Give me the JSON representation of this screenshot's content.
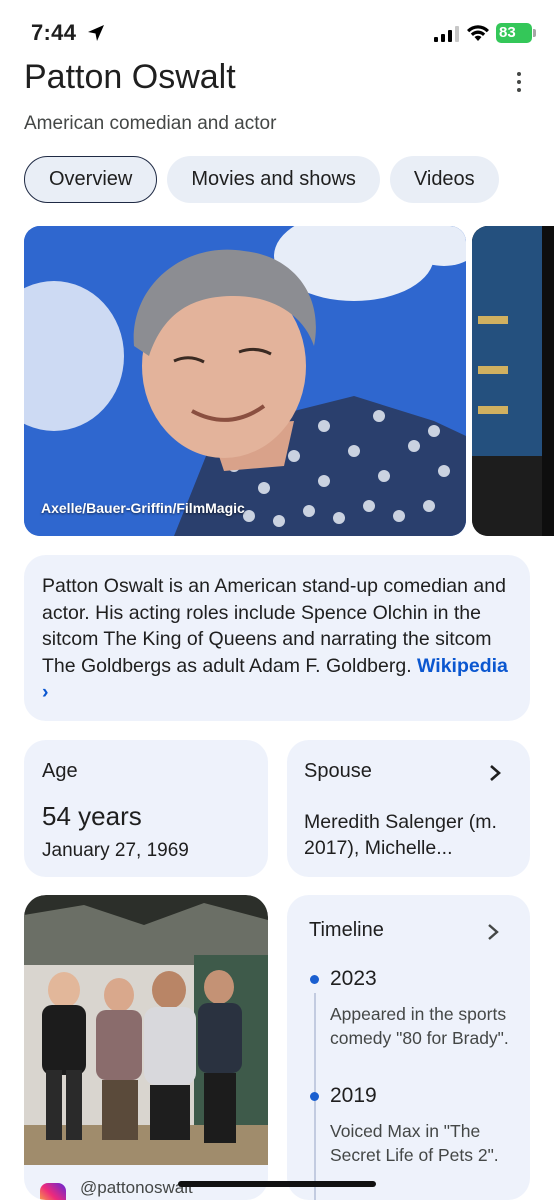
{
  "status_bar": {
    "time": "7:44",
    "battery": "83"
  },
  "header": {
    "title": "Patton Oswalt",
    "subtitle": "American comedian and actor"
  },
  "tabs": [
    {
      "label": "Overview",
      "active": true
    },
    {
      "label": "Movies and shows",
      "active": false
    },
    {
      "label": "Videos",
      "active": false
    }
  ],
  "carousel": {
    "caption": "Axelle/Bauer-Griffin/FilmMagic"
  },
  "about": {
    "text": "Patton Oswalt is an American stand-up comedian and actor. His acting roles include Spence Olchin in the sitcom The King of Queens and narrating the sitcom The Goldbergs as adult Adam F. Goldberg.",
    "link_label": "Wikipedia",
    "link_chevron": "›"
  },
  "age": {
    "label": "Age",
    "value": "54 years",
    "date": "January 27, 1969"
  },
  "spouse": {
    "label": "Spouse",
    "value": "Meredith Salenger (m. 2017), Michelle..."
  },
  "instagram": {
    "handle": "@pattonoswalt"
  },
  "timeline": {
    "label": "Timeline",
    "items": [
      {
        "year": "2023",
        "description": "Appeared in the sports comedy \"80 for Brady\"."
      },
      {
        "year": "2019",
        "description": "Voiced Max in \"The Secret Life of Pets 2\"."
      }
    ]
  },
  "colors": {
    "accent": "#0b57d0",
    "card_bg": "#eef2fb",
    "tab_bg": "#e9eef6",
    "battery": "#34c759"
  }
}
